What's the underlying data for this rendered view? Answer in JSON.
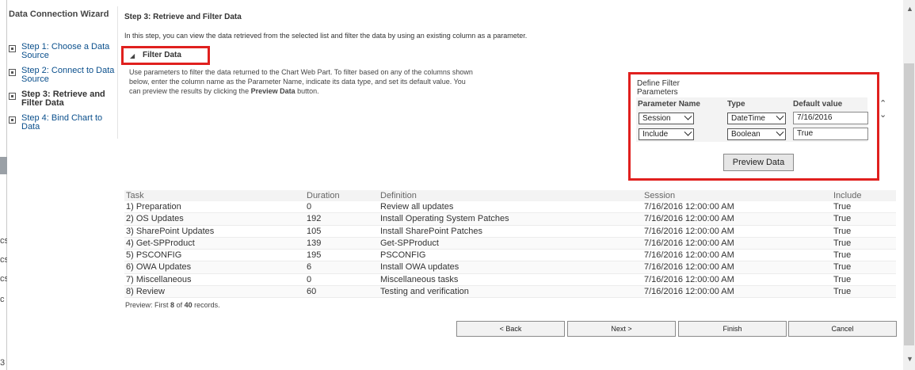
{
  "background_app": {
    "fragments": [
      "cs",
      "cs",
      "cs",
      "c",
      "3"
    ]
  },
  "wizard": {
    "title": "Data Connection Wizard",
    "steps": [
      {
        "label": "Step 1: Choose a Data Source",
        "active": false
      },
      {
        "label": "Step 2: Connect to Data Source",
        "active": false
      },
      {
        "label": "Step 3: Retrieve and Filter Data",
        "active": true
      },
      {
        "label": "Step 4: Bind Chart to Data",
        "active": false
      }
    ]
  },
  "main": {
    "step_title": "Step 3: Retrieve and Filter Data",
    "intro": "In this step, you can view the data retrieved from the selected list and filter the data by using an existing column as a parameter.",
    "filter_section_label": "Filter Data",
    "description_1": "Use parameters to filter the data returned to the Chart Web Part. To filter based on any of the columns shown below, enter the column name as the Parameter Name, indicate its data type, and set its default value. You can preview the results by clicking the",
    "description_bold": "Preview Data",
    "description_2": "button."
  },
  "filter_panel": {
    "title": "Define Filter Parameters",
    "col_param": "Parameter Name",
    "col_type": "Type",
    "col_default": "Default value",
    "rows": [
      {
        "name": "Session",
        "type": "DateTime",
        "default": "7/16/2016"
      },
      {
        "name": "Include",
        "type": "Boolean",
        "default": "True"
      }
    ],
    "preview_button": "Preview Data"
  },
  "data_table": {
    "headers": [
      "Task",
      "Duration",
      "Definition",
      "Session",
      "Include"
    ],
    "rows": [
      [
        "1) Preparation",
        "0",
        "Review all updates",
        "7/16/2016 12:00:00 AM",
        "True"
      ],
      [
        "2) OS Updates",
        "192",
        "Install Operating System Patches",
        "7/16/2016 12:00:00 AM",
        "True"
      ],
      [
        "3) SharePoint Updates",
        "105",
        "Install SharePoint Patches",
        "7/16/2016 12:00:00 AM",
        "True"
      ],
      [
        "4) Get-SPProduct",
        "139",
        "Get-SPProduct",
        "7/16/2016 12:00:00 AM",
        "True"
      ],
      [
        "5) PSCONFIG",
        "195",
        "PSCONFIG",
        "7/16/2016 12:00:00 AM",
        "True"
      ],
      [
        "6) OWA Updates",
        "6",
        "Install OWA updates",
        "7/16/2016 12:00:00 AM",
        "True"
      ],
      [
        "7) Miscellaneous",
        "0",
        "Miscellaneous tasks",
        "7/16/2016 12:00:00 AM",
        "True"
      ],
      [
        "8) Review",
        "60",
        "Testing and verification",
        "7/16/2016 12:00:00 AM",
        "True"
      ]
    ],
    "records_prefix": "Preview: First",
    "records_shown": "8",
    "records_of": "of",
    "records_total": "40",
    "records_suffix": "records."
  },
  "nav_buttons": {
    "back": "< Back",
    "next": "Next >",
    "finish": "Finish",
    "cancel": "Cancel"
  },
  "colors": {
    "highlight_border": "#e0201e",
    "link": "#0a4f8c"
  }
}
